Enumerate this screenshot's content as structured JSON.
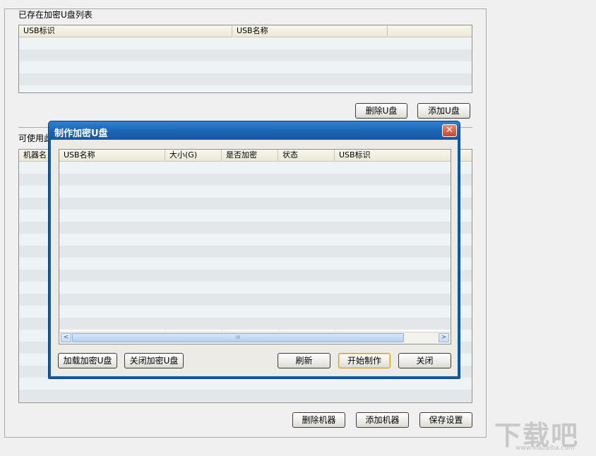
{
  "main": {
    "existing_group": {
      "label": "已存在加密U盘列表",
      "columns": [
        "USB标识",
        "USB名称",
        ""
      ],
      "delete_button": "删除U盘",
      "add_button": "添加U盘"
    },
    "machine_group": {
      "label": "可使用此",
      "column_first": "机器名",
      "delete_button": "删除机器",
      "add_button": "添加机器",
      "save_button": "保存设置"
    }
  },
  "dialog": {
    "title": "制作加密U盘",
    "close_glyph": "✕",
    "columns": [
      "USB名称",
      "大小(G)",
      "是否加密",
      "状态",
      "USB标识"
    ],
    "scroll_left": "<",
    "scroll_right": ">",
    "scroll_grip": "III",
    "buttons": {
      "load": "加载加密U盘",
      "close_encrypt": "关闭加密U盘",
      "refresh": "刷新",
      "start": "开始制作",
      "close": "关闭"
    }
  },
  "watermark": {
    "text": "下载吧",
    "url": "www.xiazaiba.com"
  }
}
